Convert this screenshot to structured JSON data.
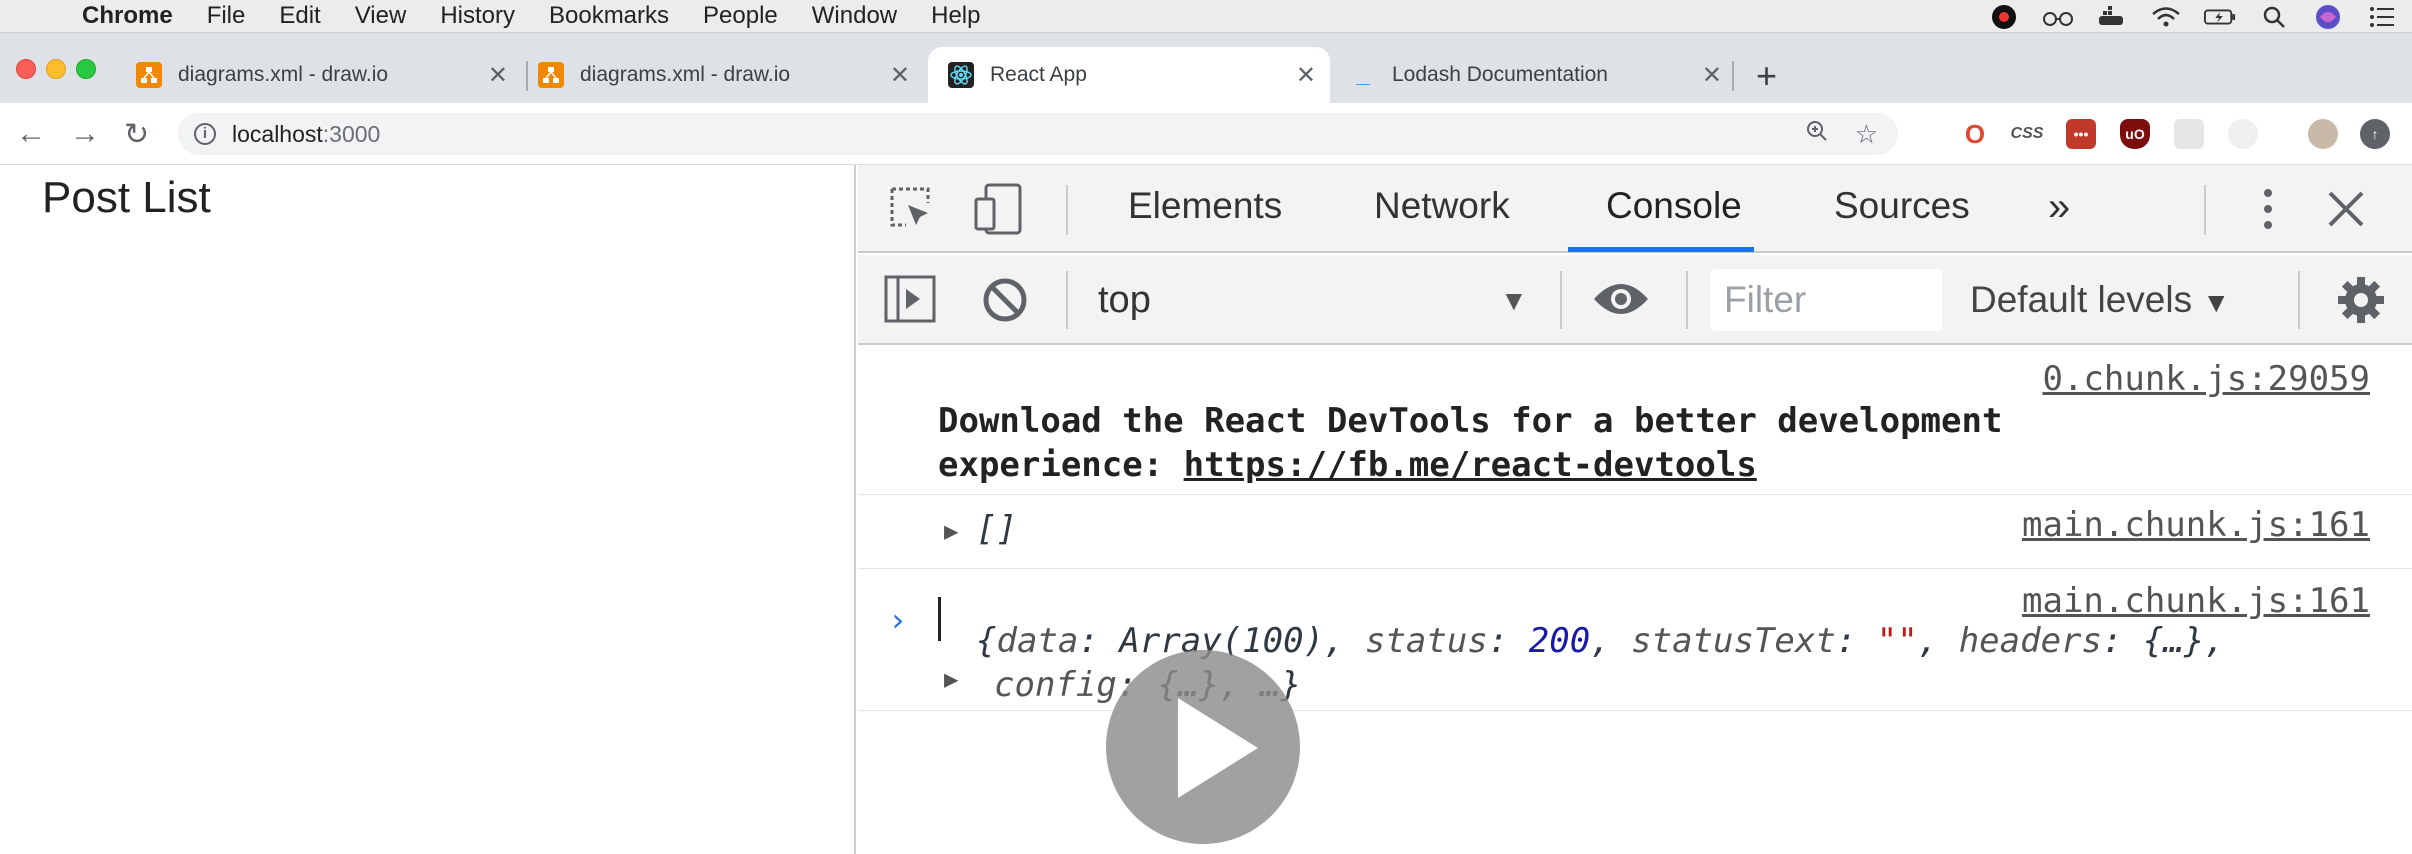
{
  "menubar": {
    "app_name": "Chrome",
    "items": [
      "File",
      "Edit",
      "View",
      "History",
      "Bookmarks",
      "People",
      "Window",
      "Help"
    ]
  },
  "tabs": [
    {
      "title": "diagrams.xml - draw.io",
      "icon": "drawio-icon",
      "active": false
    },
    {
      "title": "diagrams.xml - draw.io",
      "icon": "drawio-icon",
      "active": false
    },
    {
      "title": "React App",
      "icon": "react-icon",
      "active": true
    },
    {
      "title": "Lodash Documentation",
      "icon": "lodash-icon",
      "active": false
    }
  ],
  "address": {
    "host": "localhost",
    "port": ":3000"
  },
  "page": {
    "heading": "Post List"
  },
  "devtools": {
    "tabs": [
      "Elements",
      "Network",
      "Console",
      "Sources"
    ],
    "more": "»",
    "active_tab": "Console",
    "context": "top",
    "filter_placeholder": "Filter",
    "levels": "Default levels",
    "messages": [
      {
        "source": "0.chunk.js:29059",
        "text_prefix": "Download the React DevTools for a better development",
        "text_line2": "experience: ",
        "link": "https://fb.me/react-devtools"
      },
      {
        "source": "main.chunk.js:161",
        "value": "[]"
      },
      {
        "source": "main.chunk.js:161",
        "line1": {
          "open": "{",
          "k1": "data",
          "v1": "Array(100)",
          "k2": "status",
          "v2": "200",
          "k3": "statusText",
          "v3": "\"\"",
          "k4": "headers",
          "v4": "{…},"
        },
        "line2": {
          "k5": "config",
          "v5": "{…}",
          "rest": "…}"
        }
      }
    ]
  },
  "colors": {
    "accent": "#1a73e8",
    "number": "#1a1aa6",
    "string": "#c41a16"
  }
}
